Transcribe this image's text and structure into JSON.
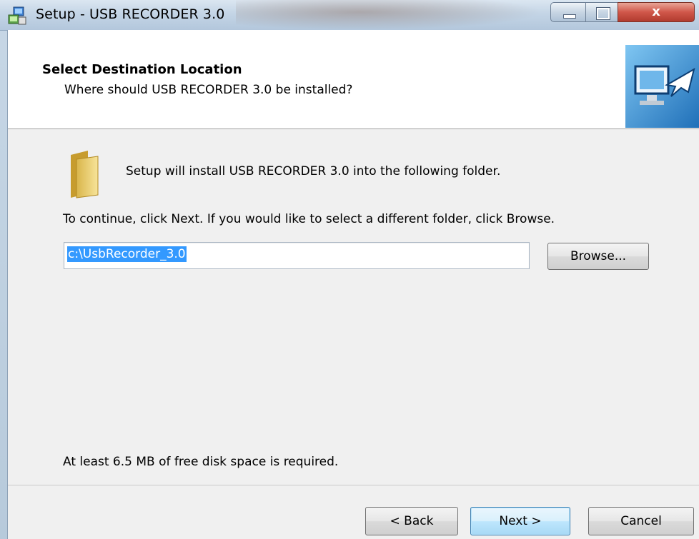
{
  "window": {
    "title": "Setup - USB RECORDER 3.0",
    "close_glyph": "x"
  },
  "header": {
    "title": "Select Destination Location",
    "subtitle": "Where should USB RECORDER 3.0 be installed?",
    "logo_icon": "computer-arrow-icon"
  },
  "main": {
    "folder_icon": "folder-icon",
    "install_text": "Setup will install USB RECORDER 3.0 into the following folder.",
    "continue_text": "To continue, click Next. If you would like to select a different folder, click Browse.",
    "path_value": "c:\\UsbRecorder_3.0",
    "browse_label": "Browse...",
    "disk_space_text": "At least 6.5 MB of free disk space is required."
  },
  "footer": {
    "back_label": "< Back",
    "next_label": "Next >",
    "cancel_label": "Cancel"
  },
  "colors": {
    "selection": "#3399ff",
    "close_button": "#d0574a",
    "default_button_border": "#3c7fb1"
  }
}
